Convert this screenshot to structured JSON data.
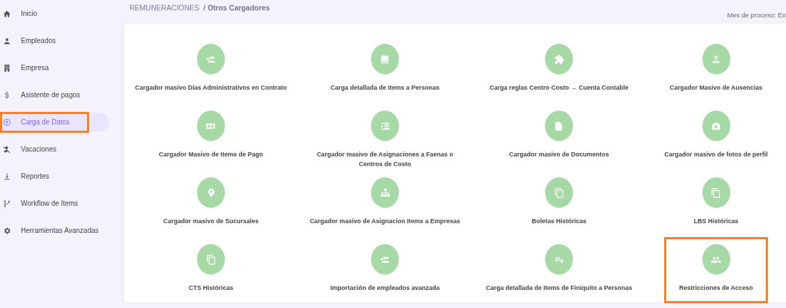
{
  "sidebar": {
    "items": [
      {
        "label": "Inicio",
        "selected": false,
        "highlighted": false
      },
      {
        "label": "Empleados",
        "selected": false,
        "highlighted": false
      },
      {
        "label": "Empresa",
        "selected": false,
        "highlighted": false
      },
      {
        "label": "Asistente de pagos",
        "selected": false,
        "highlighted": false
      },
      {
        "label": "Carga de Datos",
        "selected": true,
        "highlighted": true
      },
      {
        "label": "Vacaciones",
        "selected": false,
        "highlighted": false
      },
      {
        "label": "Reportes",
        "selected": false,
        "highlighted": false
      },
      {
        "label": "Workflow de Items",
        "selected": false,
        "highlighted": false
      },
      {
        "label": "Herramientas Avanzadas",
        "selected": false,
        "highlighted": false
      }
    ]
  },
  "header": {
    "breadcrumb": [
      "REMUNERACIONES",
      "/ Otros Cargadores"
    ],
    "process_month": "Mes de proceso: En"
  },
  "tiles": [
    {
      "label": "Cargador masivo Días Administrativos en Contrato",
      "highlighted": false
    },
    {
      "label": "Carga detallada de Items a Personas",
      "highlighted": false
    },
    {
      "label": "Carga reglas Centro Costo → Cuenta Contable",
      "highlighted": false
    },
    {
      "label": "Cargador Masivo de Ausencias",
      "highlighted": false
    },
    {
      "label": "Cargador Masivo de Items de Pago",
      "highlighted": false
    },
    {
      "label": "Cargador masivo de Asignaciones a Faenas o Centros de Costo",
      "highlighted": false
    },
    {
      "label": "Cargador masivo de Documentos",
      "highlighted": false
    },
    {
      "label": "Cargador masivo de fotos de perfil",
      "highlighted": false
    },
    {
      "label": "Cargador masivo de Sucursales",
      "highlighted": false
    },
    {
      "label": "Cargador masivo de Asignacion Items a Empresas",
      "highlighted": false
    },
    {
      "label": "Boletas Históricas",
      "highlighted": false
    },
    {
      "label": "LBS Históricas",
      "highlighted": false
    },
    {
      "label": "CTS Históricas",
      "highlighted": false
    },
    {
      "label": "Importación de empleados avanzada",
      "highlighted": false
    },
    {
      "label": "Carga detallada de Items de Finiquito a Personas",
      "highlighted": false
    },
    {
      "label": "Restricciones de Acceso",
      "highlighted": true
    }
  ]
}
